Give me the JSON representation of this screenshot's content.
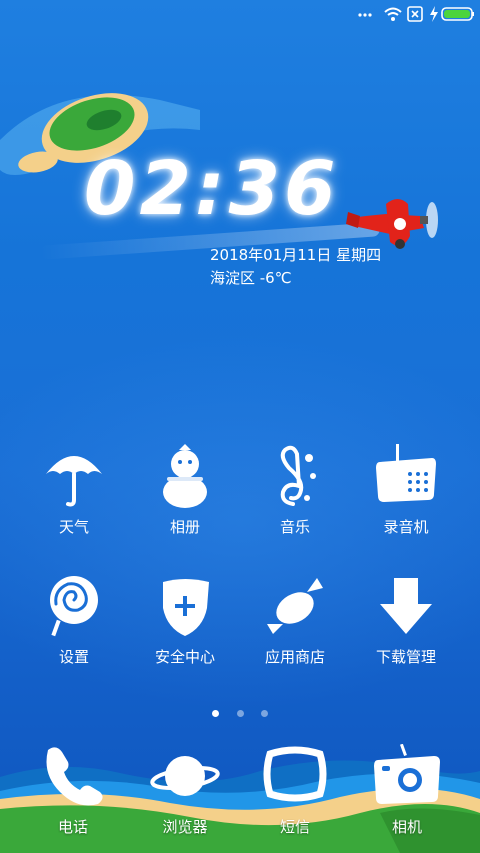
{
  "status_bar": {
    "icons": [
      "wifi-icon",
      "sim-x-icon",
      "charging-icon",
      "battery-icon"
    ],
    "battery_color": "#4cd43c"
  },
  "lockscreen": {
    "time": "02:36",
    "date": "2018年01月11日  星期四",
    "location_weather": "海淀区 -6℃"
  },
  "apps": [
    {
      "label": "天气",
      "icon": "umbrella-icon"
    },
    {
      "label": "相册",
      "icon": "snowman-icon"
    },
    {
      "label": "音乐",
      "icon": "music-note-icon"
    },
    {
      "label": "录音机",
      "icon": "recorder-icon"
    },
    {
      "label": "设置",
      "icon": "spiral-lollipop-icon"
    },
    {
      "label": "安全中心",
      "icon": "shield-plus-icon"
    },
    {
      "label": "应用商店",
      "icon": "candy-icon"
    },
    {
      "label": "下载管理",
      "icon": "download-arrow-icon"
    }
  ],
  "page_indicator": {
    "pages": 3,
    "current": 1
  },
  "dock": [
    {
      "label": "电话",
      "icon": "phone-icon"
    },
    {
      "label": "浏览器",
      "icon": "planet-icon"
    },
    {
      "label": "短信",
      "icon": "message-frame-icon"
    },
    {
      "label": "相机",
      "icon": "camera-icon"
    }
  ],
  "colors": {
    "wallpaper": "#1a6fd6",
    "plane": "#e2231a",
    "grass": "#3aa83a",
    "sand": "#f4d08a"
  }
}
